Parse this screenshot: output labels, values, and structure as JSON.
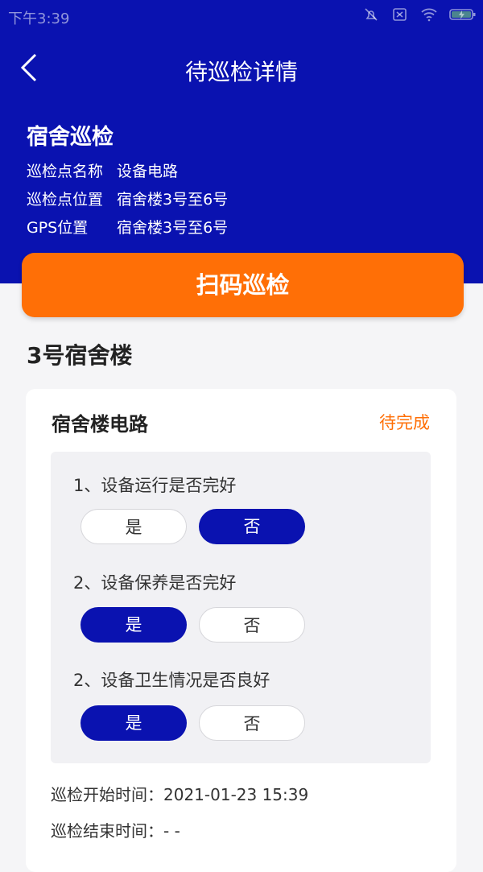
{
  "status_bar": {
    "time": "下午3:39"
  },
  "header": {
    "title": "待巡检详情"
  },
  "site": {
    "name": "宿舍巡检",
    "rows": [
      {
        "label": "巡检点名称",
        "value": "设备电路"
      },
      {
        "label": "巡检点位置",
        "value": "宿舍楼3号至6号"
      },
      {
        "label": "GPS位置",
        "value": "宿舍楼3号至6号"
      }
    ]
  },
  "scan_button": {
    "label": "扫码巡检"
  },
  "building": "3号宿舍楼",
  "card": {
    "title": "宿舍楼电路",
    "status": "待完成",
    "questions": [
      {
        "text": "1、设备运行是否完好",
        "yes": "是",
        "no": "否",
        "selected": "no"
      },
      {
        "text": "2、设备保养是否完好",
        "yes": "是",
        "no": "否",
        "selected": "yes"
      },
      {
        "text": "2、设备卫生情况是否良好",
        "yes": "是",
        "no": "否",
        "selected": "yes"
      }
    ],
    "start_time": "巡检开始时间：2021-01-23 15:39",
    "end_time": "巡检结束时间：- -"
  },
  "colors": {
    "primary": "#0a12b0",
    "accent": "#ff6f06"
  }
}
